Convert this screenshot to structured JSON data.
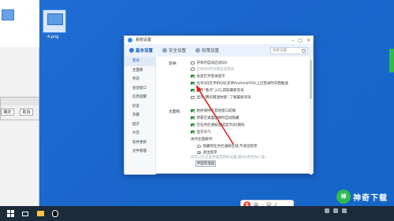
{
  "desktop": {
    "file_label": "4.png",
    "dialog_buttons": [
      "确定",
      "取消"
    ]
  },
  "window": {
    "title": "系统设置",
    "controls": [
      "–",
      "□",
      "×"
    ],
    "tabs": [
      {
        "label": "基本设置",
        "active": true
      },
      {
        "label": "安全设置",
        "active": false
      },
      {
        "label": "权限设置",
        "active": false
      }
    ],
    "search_placeholder": "搜索设置"
  },
  "sidebar": {
    "items": [
      "登录",
      "主面板",
      "状态",
      "会话窗口",
      "信息提醒",
      "好友",
      "热键",
      "提示",
      "声音",
      "软件更新",
      "文件管理"
    ],
    "active_index": 0
  },
  "login_section": {
    "label": "登录:",
    "options": [
      {
        "text": "开机时自动启动QQ",
        "checked": false,
        "gray": false
      },
      {
        "text": "启动QQ时为我自动登录",
        "checked": false,
        "gray": true
      },
      {
        "text": "总是打开登录提示",
        "checked": true,
        "gray": false
      },
      {
        "text": "允许QQ在手机QQ(支持Android/iOS)上已登录时向我推送",
        "checked": true,
        "gray": false
      },
      {
        "text": "显示“看点”入口,获取最新资讯",
        "checked": true,
        "gray": false
      },
      {
        "text": "显示“腾讯网迷你版”,了解最新资讯",
        "checked": false,
        "gray": false
      }
    ]
  },
  "panel_section": {
    "label": "主面板:",
    "options": [
      {
        "text": "始终保持在其他窗口前端",
        "checked": true
      },
      {
        "text": "停靠在桌面边缘时自动隐藏",
        "checked": true
      },
      {
        "text": "在任务栏通知区域显示QQ图标",
        "checked": true
      },
      {
        "text": "显示天气",
        "checked": true
      }
    ],
    "close_label": "关闭主面板时:",
    "close_options": [
      {
        "text": "隐藏到任务栏通知区域,不退出程序",
        "selected": false
      },
      {
        "text": "退出程序",
        "selected": true
      }
    ],
    "note": "你可以在这里管理常用的设置,使QQ更合你心意。",
    "manage_button": "界面管理器"
  },
  "taskbar": {
    "ime_label": "中",
    "ime_logo": "S"
  },
  "watermark": {
    "logo_text": "神",
    "text": "神奇下载"
  }
}
